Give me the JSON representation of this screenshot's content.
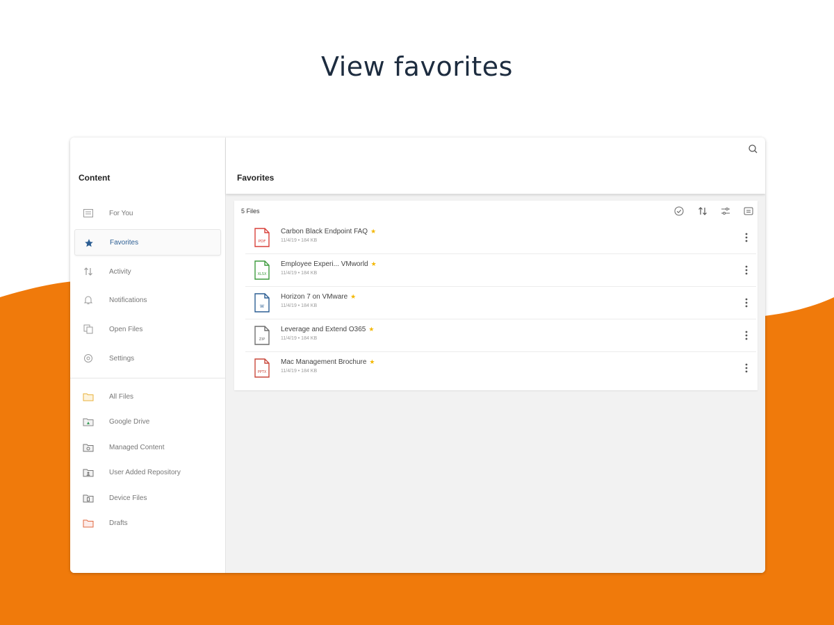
{
  "headline": "View favorites",
  "colors": {
    "brand_orange": "#f07a0b",
    "headline": "#1d2c3f",
    "accent_blue": "#2c5e93",
    "star": "#f3b700"
  },
  "sidebar": {
    "title": "Content",
    "primary_items": [
      {
        "label": "For You",
        "icon": "news-feed-icon",
        "active": false
      },
      {
        "label": "Favorites",
        "icon": "star-icon",
        "active": true
      },
      {
        "label": "Activity",
        "icon": "sort-arrows-icon",
        "active": false
      },
      {
        "label": "Notifications",
        "icon": "bell-icon",
        "active": false
      },
      {
        "label": "Open Files",
        "icon": "open-files-icon",
        "active": false
      },
      {
        "label": "Settings",
        "icon": "gear-icon",
        "active": false
      }
    ],
    "repository_items": [
      {
        "label": "All Files",
        "icon": "folder-icon"
      },
      {
        "label": "Google Drive",
        "icon": "google-drive-folder-icon"
      },
      {
        "label": "Managed Content",
        "icon": "managed-content-folder-icon"
      },
      {
        "label": "User Added Repository",
        "icon": "user-repository-folder-icon"
      },
      {
        "label": "Device Files",
        "icon": "device-folder-icon"
      },
      {
        "label": "Drafts",
        "icon": "drafts-folder-icon"
      }
    ]
  },
  "main": {
    "title": "Favorites",
    "file_count": "5 Files",
    "toolbar": [
      "select-check-icon",
      "sort-icon",
      "filter-icon",
      "view-toggle-icon"
    ],
    "files": [
      {
        "name": "Carbon Black Endpoint FAQ",
        "meta": "11/4/19 • 184 KB",
        "type": "PDF",
        "color": "#d9403a"
      },
      {
        "name": "Employee Experi... VMworld",
        "meta": "11/4/19 • 184 KB",
        "type": "XLSX",
        "color": "#3c9a3c"
      },
      {
        "name": "Horizon 7 on VMware",
        "meta": "11/4/19 • 184 KB",
        "type": "W",
        "color": "#2c5e93"
      },
      {
        "name": "Leverage and Extend O365",
        "meta": "11/4/19 • 184 KB",
        "type": "ZIP",
        "color": "#6f6f6f"
      },
      {
        "name": "Mac Management Brochure",
        "meta": "11/4/19 • 184 KB",
        "type": "PPTX",
        "color": "#c9473a"
      }
    ]
  }
}
